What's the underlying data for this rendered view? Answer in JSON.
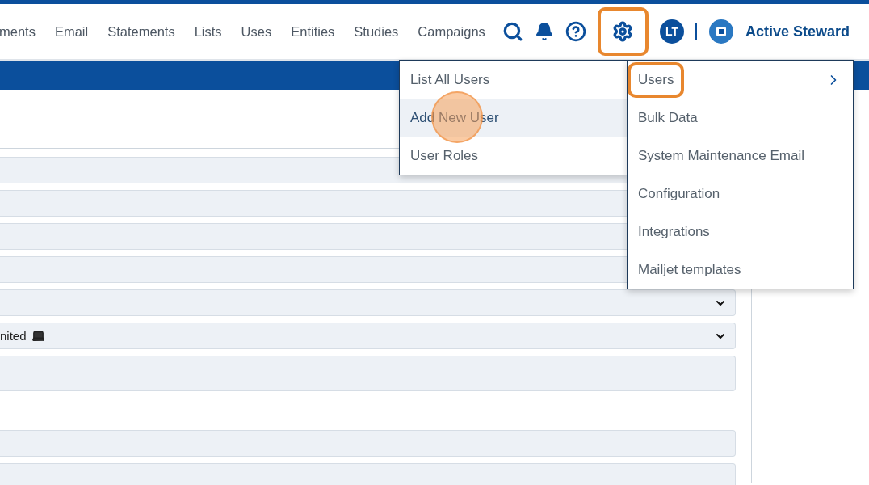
{
  "nav": {
    "items": [
      "ments",
      "Email",
      "Statements",
      "Lists",
      "Uses",
      "Entities",
      "Studies",
      "Campaigns"
    ],
    "avatar": "LT",
    "brand": "Active Steward",
    "settings_highlighted": true
  },
  "settings_menu": {
    "items": [
      {
        "label": "Users",
        "has_submenu": true,
        "highlighted": true
      },
      {
        "label": "Bulk Data",
        "has_submenu": false,
        "highlighted": false
      },
      {
        "label": "System Maintenance Email",
        "has_submenu": false,
        "highlighted": false
      },
      {
        "label": "Configuration",
        "has_submenu": false,
        "highlighted": false
      },
      {
        "label": "Integrations",
        "has_submenu": false,
        "highlighted": false
      },
      {
        "label": "Mailjet templates",
        "has_submenu": false,
        "highlighted": false
      }
    ]
  },
  "users_submenu": {
    "items": [
      {
        "label": "List All Users",
        "hovered": false,
        "clicked": false
      },
      {
        "label": "Add New User",
        "hovered": true,
        "clicked": true
      },
      {
        "label": "User Roles",
        "hovered": false,
        "clicked": false
      }
    ]
  },
  "form": {
    "fields": [
      {
        "kind": "text"
      },
      {
        "kind": "text"
      },
      {
        "kind": "text"
      },
      {
        "kind": "text"
      },
      {
        "kind": "select"
      },
      {
        "kind": "select",
        "value": "nited",
        "laptop_icon": true
      },
      {
        "kind": "textarea"
      },
      {
        "kind": "gap"
      },
      {
        "kind": "text"
      },
      {
        "kind": "textarea"
      }
    ]
  }
}
